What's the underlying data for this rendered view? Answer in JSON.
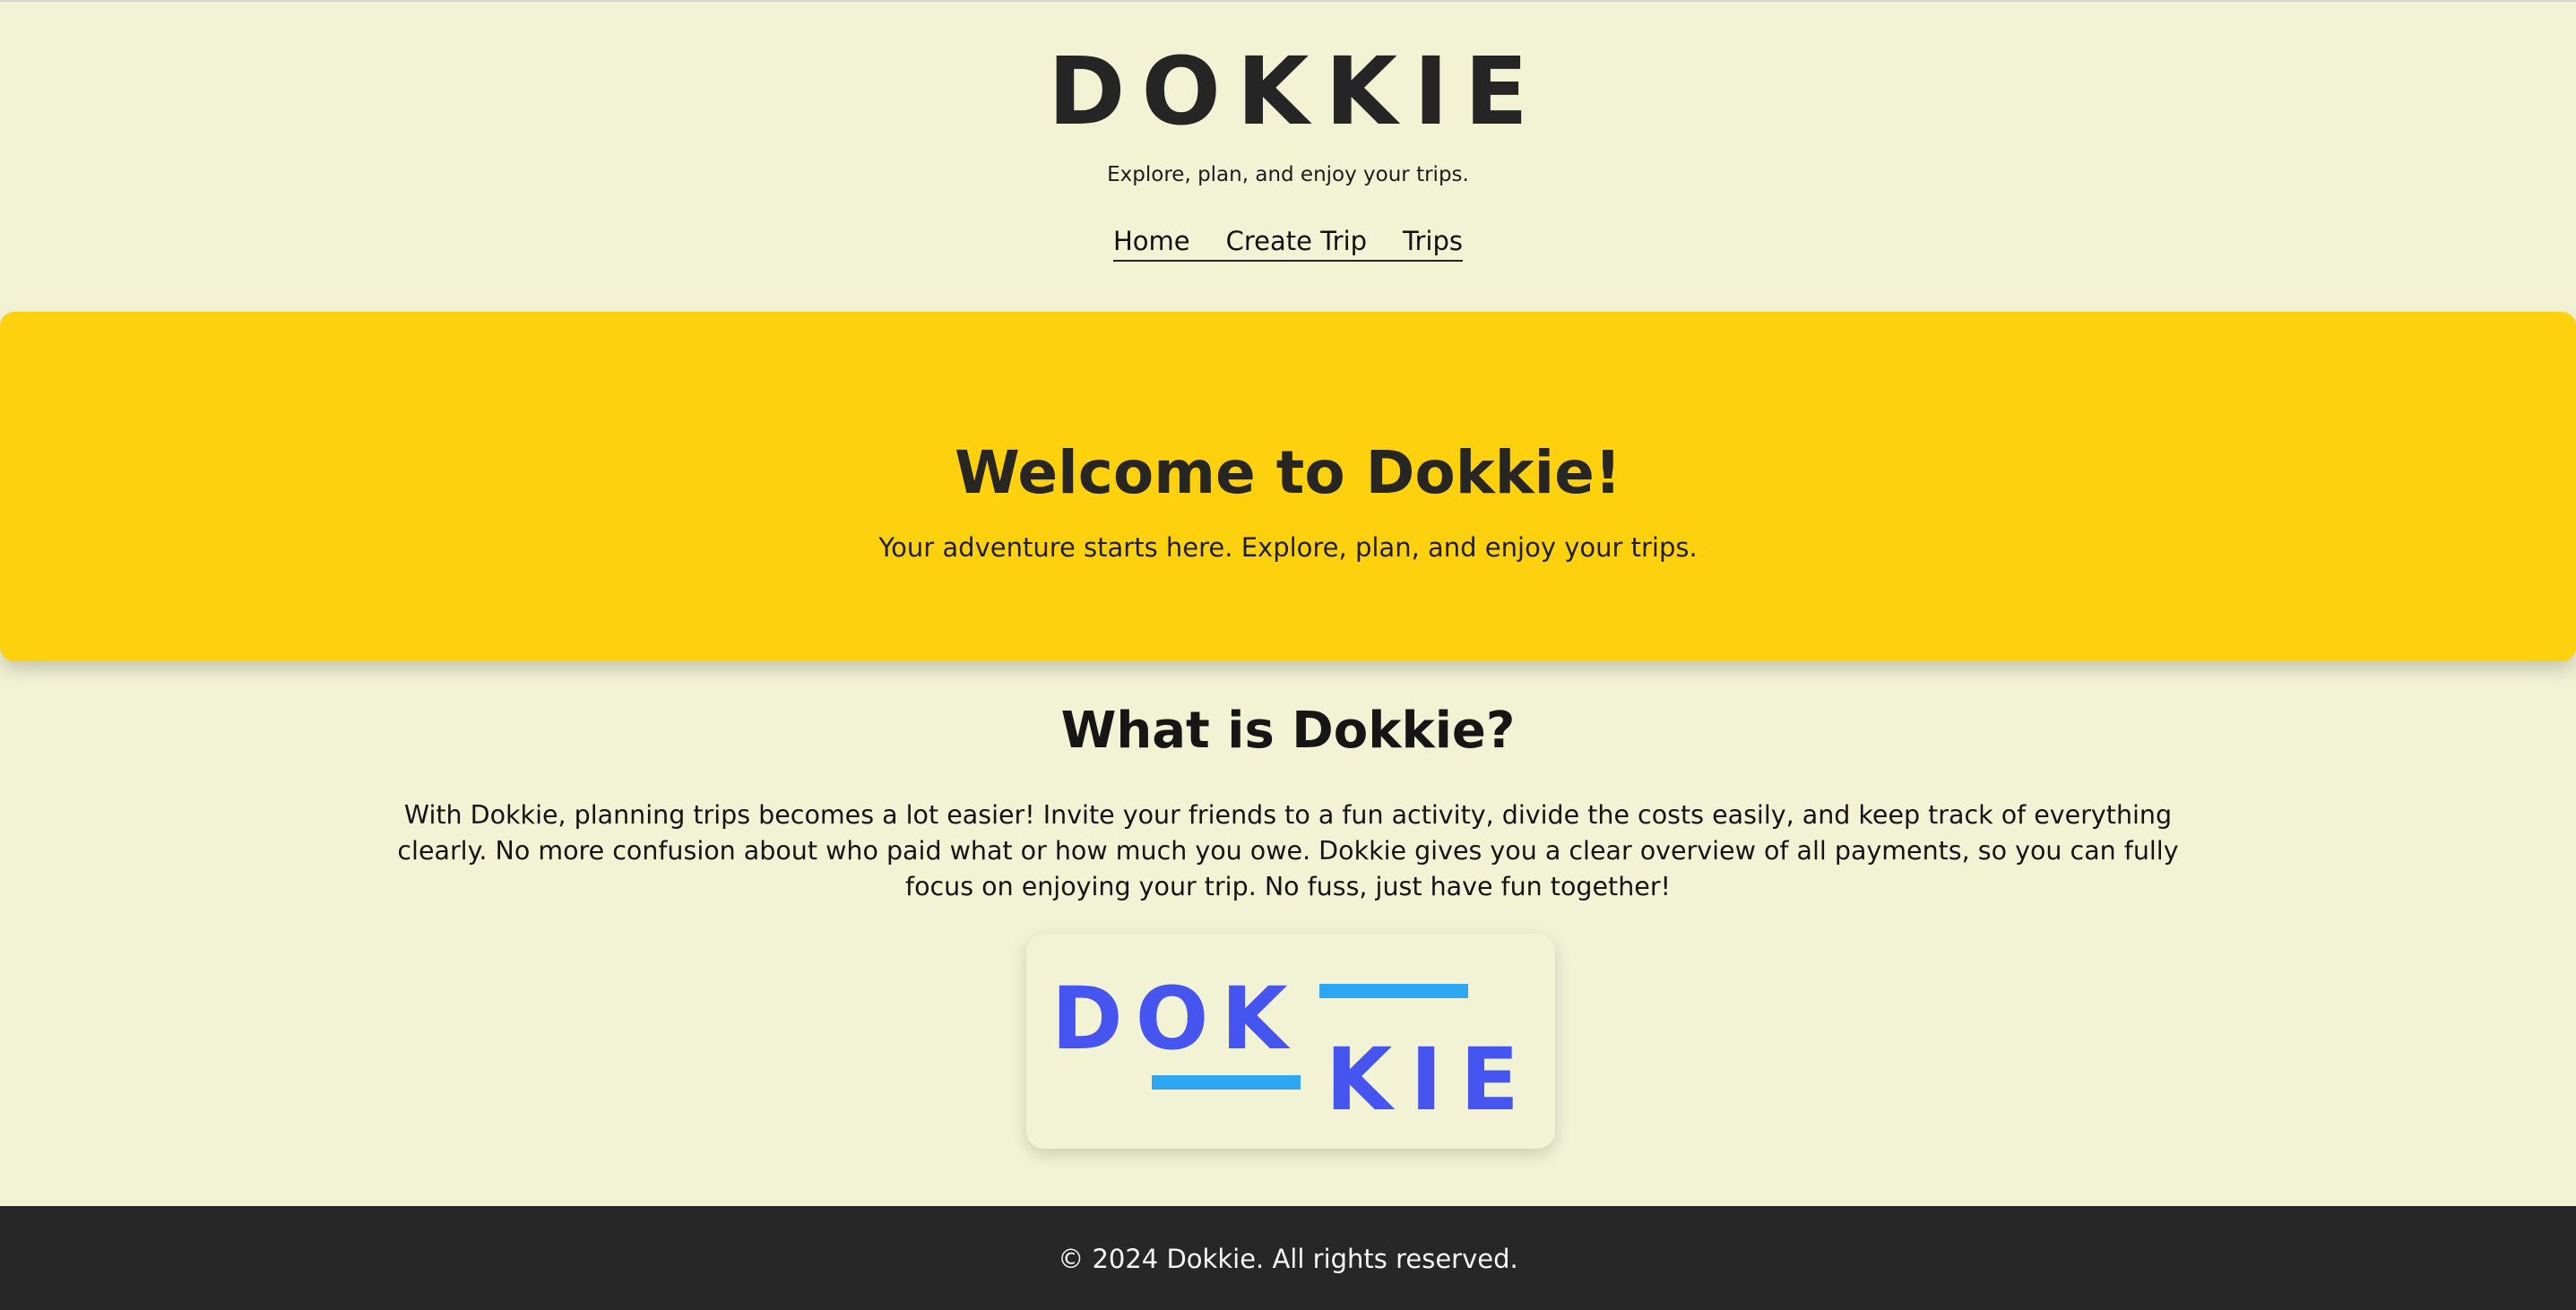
{
  "header": {
    "brand": "DOKKIE",
    "tagline": "Explore, plan, and enjoy your trips."
  },
  "nav": {
    "items": [
      {
        "label": "Home"
      },
      {
        "label": "Create Trip"
      },
      {
        "label": "Trips"
      }
    ]
  },
  "hero": {
    "title": "Welcome to Dokkie!",
    "subtitle": "Your adventure starts here. Explore, plan, and enjoy your trips."
  },
  "about": {
    "title": "What is Dokkie?",
    "text": "With Dokkie, planning trips becomes a lot easier! Invite your friends to a fun activity, divide the costs easily, and keep track of everything clearly. No more confusion about who paid what or how much you owe. Dokkie gives you a clear overview of all payments, so you can fully focus on enjoying your trip. No fuss, just have fun together!"
  },
  "logo": {
    "top_letters": "DOK",
    "bottom_letters": "KIE",
    "letter_color": "#4654f0",
    "bar_color": "#2ea6f2"
  },
  "footer": {
    "text": "© 2024 Dokkie. All rights reserved."
  },
  "colors": {
    "background": "#f2f3d5",
    "hero": "#fed10f",
    "footer": "#272727",
    "text_dark": "#252525"
  }
}
